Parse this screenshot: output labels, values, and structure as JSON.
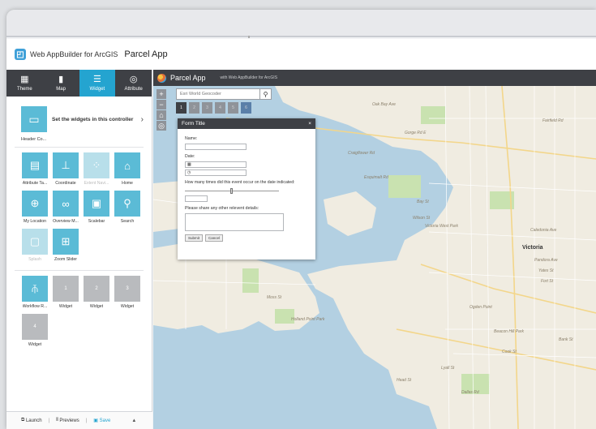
{
  "header": {
    "builder_title": "Web AppBuilder for ArcGIS",
    "app_name": "Parcel App"
  },
  "tabs": [
    {
      "label": "Theme",
      "icon": "theme-icon"
    },
    {
      "label": "Map",
      "icon": "map-icon"
    },
    {
      "label": "Widget",
      "icon": "widget-icon",
      "active": true
    },
    {
      "label": "Attribute",
      "icon": "attribute-icon"
    }
  ],
  "controller": {
    "text": "Set the widgets in this controller",
    "caption": "Header Co..."
  },
  "widgets": [
    {
      "label": "Attribute Ta...",
      "icon": "table-icon"
    },
    {
      "label": "Coordinate",
      "icon": "coordinate-icon"
    },
    {
      "label": "Extent Navi...",
      "icon": "extent-icon",
      "disabled": true
    },
    {
      "label": "Home",
      "icon": "home-icon"
    },
    {
      "label": "My Location",
      "icon": "location-icon"
    },
    {
      "label": "Overview M...",
      "icon": "binoculars-icon"
    },
    {
      "label": "Scalebar",
      "icon": "scalebar-icon"
    },
    {
      "label": "Search",
      "icon": "search-icon"
    },
    {
      "label": "Splash",
      "icon": "splash-icon",
      "disabled": true
    },
    {
      "label": "Zoom Slider",
      "icon": "zoom-slider-icon"
    }
  ],
  "placeholders": [
    {
      "label": "Workflow R...",
      "num": ""
    },
    {
      "label": "Widget",
      "num": "1"
    },
    {
      "label": "Widget",
      "num": "2"
    },
    {
      "label": "Widget",
      "num": "3"
    },
    {
      "label": "Widget",
      "num": "4"
    }
  ],
  "bottom": {
    "launch": "Launch",
    "previews": "Previews",
    "save": "Save"
  },
  "app_bar": {
    "title": "Parcel App",
    "subtitle": "with Web AppBuilder for ArcGIS"
  },
  "map": {
    "geocoder_placeholder": "Esri World Geocoder",
    "placeholder_tabs": [
      "1",
      "2",
      "3",
      "4",
      "5",
      "6"
    ],
    "labels": [
      "Ogden Point",
      "Victoria",
      "Dallas Rd",
      "Fairfield Rd",
      "Bay St",
      "Gorge Rd E",
      "Esquimalt Rd",
      "Craigflower Rd",
      "Wilson St",
      "Holland Point Park",
      "Beacon Hill Park",
      "Cook St",
      "Pandora Ave",
      "Yates St",
      "Fort St",
      "Caledonia Ave",
      "Moss St",
      "Bank St",
      "Lyall St",
      "Head St",
      "Oak Bay Ave",
      "Victoria West Park"
    ]
  },
  "form": {
    "title": "Form Title",
    "name_label": "Name:",
    "date_label": "Date:",
    "count_label": "How many times did this event occur on the date indicated:",
    "details_label": "Please share any other relevent details:",
    "submit": "Submit",
    "cancel": "Cancel",
    "slider_value": 0.5
  }
}
